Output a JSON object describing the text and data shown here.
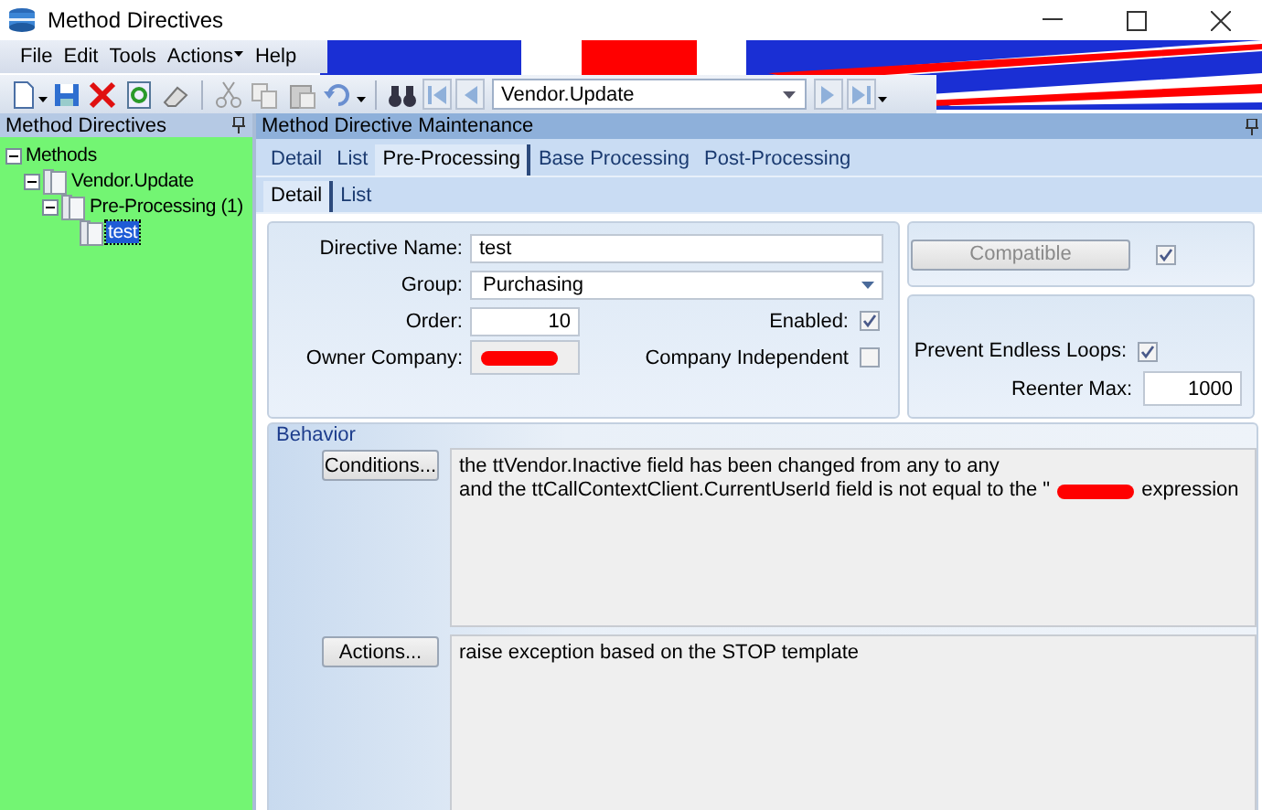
{
  "window": {
    "title": "Method Directives"
  },
  "menu": [
    {
      "label": "File",
      "dropdown": false
    },
    {
      "label": "Edit",
      "dropdown": false
    },
    {
      "label": "Tools",
      "dropdown": false
    },
    {
      "label": "Actions",
      "dropdown": true
    },
    {
      "label": "Help",
      "dropdown": false
    }
  ],
  "toolbar": {
    "record": "Vendor.Update"
  },
  "tree_panel": {
    "title": "Method Directives",
    "tree": [
      {
        "label": "Methods",
        "expanded": true,
        "selected": false,
        "children": [
          {
            "label": "Vendor.Update",
            "expanded": true,
            "selected": false,
            "children": [
              {
                "label": "Pre-Processing (1)",
                "expanded": true,
                "selected": false,
                "children": [
                  {
                    "label": "test",
                    "selected": true
                  }
                ]
              }
            ]
          }
        ]
      }
    ]
  },
  "maintenance": {
    "title": "Method Directive Maintenance",
    "tabs": [
      {
        "label": "Detail",
        "selected": false
      },
      {
        "label": "List",
        "selected": false
      },
      {
        "label": "Pre-Processing",
        "selected": true
      },
      {
        "label": "Base Processing",
        "selected": false
      },
      {
        "label": "Post-Processing",
        "selected": false
      }
    ],
    "subtabs": [
      {
        "label": "Detail",
        "selected": true
      },
      {
        "label": "List",
        "selected": false
      }
    ],
    "form": {
      "directive_name_label": "Directive Name:",
      "directive_name": "test",
      "group_label": "Group:",
      "group": "Purchasing",
      "order_label": "Order:",
      "order": "10",
      "owner_company_label": "Owner Company:",
      "owner_company_redacted": true,
      "enabled_label": "Enabled:",
      "enabled": true,
      "company_independent_label": "Company Independent",
      "company_independent": false,
      "compatible_button": "Compatible",
      "compatible_disabled": true,
      "compatible": true,
      "prevent_loops_label": "Prevent Endless Loops:",
      "prevent_loops": true,
      "reenter_max_label": "Reenter Max:",
      "reenter_max": "1000"
    },
    "behavior": {
      "title": "Behavior",
      "conditions_button": "Conditions...",
      "conditions": [
        {
          "text": "the ttVendor.Inactive field has been changed from any to any",
          "redacted": false
        },
        {
          "text": "and the ttCallContextClient.CurrentUserId field is not equal to the \"",
          "redacted": true,
          "text_after": "expression"
        }
      ],
      "actions_button": "Actions...",
      "actions": [
        "raise exception based on the STOP template"
      ]
    }
  }
}
